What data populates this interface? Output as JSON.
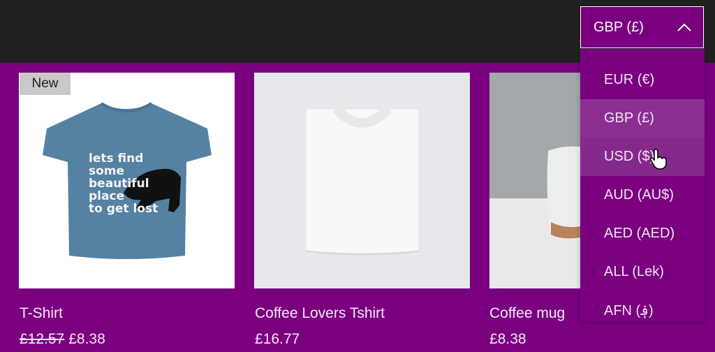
{
  "header": {
    "currency_selector": {
      "value": "GBP (£)",
      "icon": "chevron-up-icon"
    }
  },
  "currency_dropdown": {
    "options": [
      {
        "label": "EUR (€)"
      },
      {
        "label": "GBP (£)",
        "selected": true
      },
      {
        "label": "USD ($)",
        "hovered": true
      },
      {
        "label": "AUD (AU$)"
      },
      {
        "label": "AED (AED)"
      },
      {
        "label": "ALL (Lek)"
      },
      {
        "label": "AFN (؋)"
      }
    ]
  },
  "products": [
    {
      "name": "T-Shirt",
      "badge": "New",
      "original_price": "£12.57",
      "price": "£8.38",
      "print_text": [
        "lets find",
        "some",
        "beautiful",
        "place",
        "to get lost"
      ]
    },
    {
      "name": "Coffee Lovers Tshirt",
      "price": "£16.77"
    },
    {
      "name": "Coffee mug",
      "price": "£8.38"
    }
  ],
  "colors": {
    "topbar": "#202020",
    "background": "#7a0080",
    "selected_option": "#8b2f91",
    "tshirt_blue": "#5581a3",
    "badge": "#c9c9c9"
  }
}
